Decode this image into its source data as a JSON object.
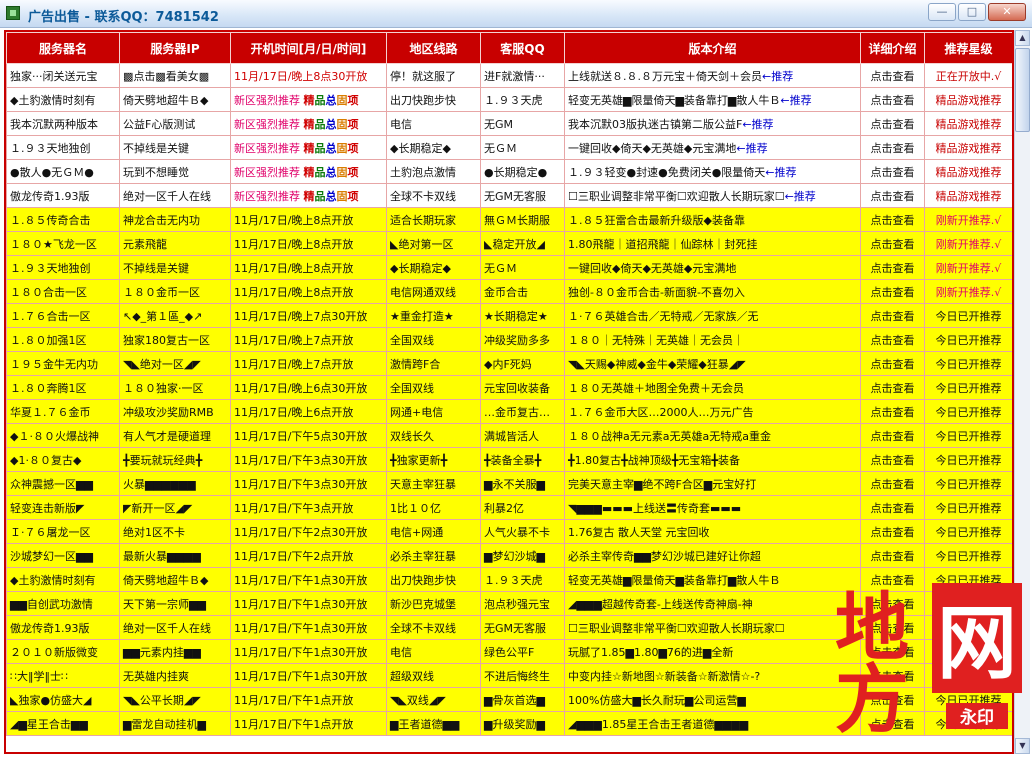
{
  "window": {
    "title": "广告出售 - 联系QQ：7481542",
    "minimize": "—",
    "maximize": "□",
    "close": "✕"
  },
  "headers": [
    "服务器名",
    "服务器IP",
    "开机时间[月/日/时间]",
    "地区线路",
    "客服QQ",
    "版本介绍",
    "详细介绍",
    "推荐星级"
  ],
  "rows": [
    {
      "style": "w",
      "name": "独家···闭关送元宝",
      "ip": "▩点击▩看美女▩",
      "time": "11月/17日/晚上8点30开放",
      "line": "停！就这服了",
      "qq": "进F就激情···",
      "intro": "上线就送８.８.８万元宝＋倚天剑＋会员",
      "intro_tail": "←推荐",
      "detail": "点击查看",
      "rate": "正在开放中.√"
    },
    {
      "style": "w",
      "name": "◆土豹激情时刻有",
      "ip": "倚天劈地超牛Ｂ◆",
      "time": "新区强烈推荐",
      "tags": [
        "精",
        "品",
        "总",
        "固",
        "项"
      ],
      "line": "出刀快跑步快",
      "qq": "１.９３天虎",
      "intro": "轻变无英雄▆限量倚天▆装备靠打▆散人牛Ｂ",
      "intro_tail": "←推荐",
      "detail": "点击查看",
      "rate": "精品游戏推荐"
    },
    {
      "style": "w",
      "name": "我本沉默两种版本",
      "ip": "公益F心版测试",
      "time": "新区强烈推荐",
      "tags": [
        "精",
        "品",
        "总",
        "固",
        "项"
      ],
      "line": "电信",
      "qq": "无GM",
      "intro": "我本沉默03版执迷古镇第二版公益F",
      "intro_tail": "←推荐",
      "detail": "点击查看",
      "rate": "精品游戏推荐"
    },
    {
      "style": "w",
      "name": "１.９３天地独创",
      "ip": "不掉线是关键",
      "time": "新区强烈推荐",
      "tags": [
        "精",
        "品",
        "总",
        "固",
        "项"
      ],
      "line": "◆长期稳定◆",
      "qq": "无ＧＭ",
      "intro": "一键回收◆倚天◆无英雄◆元宝满地",
      "intro_tail": "←推荐",
      "detail": "点击查看",
      "rate": "精品游戏推荐"
    },
    {
      "style": "w",
      "name": "●散人●无ＧＭ●",
      "ip": "玩到不想睡觉",
      "time": "新区强烈推荐",
      "tags": [
        "精",
        "品",
        "总",
        "固",
        "项"
      ],
      "line": "土豹泡点激情",
      "qq": "●长期稳定●",
      "intro": "１.９３轻变●封速●免费闭关●限量倚天",
      "intro_tail": "←推荐",
      "detail": "点击查看",
      "rate": "精品游戏推荐"
    },
    {
      "style": "w",
      "name": "傲龙传奇1.93版",
      "ip": "绝对一区千人在线",
      "time": "新区强烈推荐",
      "tags": [
        "精",
        "品",
        "总",
        "固",
        "项"
      ],
      "line": "全球不卡双线",
      "qq": "无GM无客服",
      "intro": "☐三职业调整非常平衡☐欢迎散人长期玩家☐",
      "intro_tail": "←推荐",
      "detail": "点击查看",
      "rate": "精品游戏推荐"
    },
    {
      "style": "y",
      "name": "１.８５传奇合击",
      "ip": "神龙合击无内功",
      "time": "11月/17日/晚上8点开放",
      "line": "适合长期玩家",
      "qq": "無ＧＭ长期服",
      "intro": "１.８５狂雷合击最新升级版◆装备靠",
      "detail": "点击查看",
      "rate": "刚新开推荐.√",
      "hot": true
    },
    {
      "style": "y",
      "name": "１８０★飞龙一区",
      "ip": "元素飛龍",
      "time": "11月/17日/晚上8点开放",
      "line": "◣绝对第一区",
      "qq": "◣稳定开放◢",
      "intro": "1.80飛龍｜道招飛龍｜仙踪林｜封死挂",
      "detail": "点击查看",
      "rate": "刚新开推荐.√",
      "hot": true
    },
    {
      "style": "y",
      "name": "１.９３天地独创",
      "ip": "不掉线是关键",
      "time": "11月/17日/晚上8点开放",
      "line": "◆长期稳定◆",
      "qq": "无ＧＭ",
      "intro": "一键回收◆倚天◆无英雄◆元宝满地",
      "detail": "点击查看",
      "rate": "刚新开推荐.√",
      "hot": true
    },
    {
      "style": "y",
      "name": "１８０合击一区",
      "ip": "１８０金币一区",
      "time": "11月/17日/晚上8点开放",
      "line": "电信网通双线",
      "qq": "金币合击",
      "intro": "独创-８０金币合击-新面貌-不喜勿入",
      "detail": "点击查看",
      "rate": "刚新开推荐.√",
      "hot": true
    },
    {
      "style": "y",
      "name": "１.７６合击一区",
      "ip": "↖◆_第１區_◆↗",
      "time": "11月/17日/晚上7点30开放",
      "line": "★重金打造★",
      "qq": "★长期稳定★",
      "intro": "１·７６英雄合击／无特戒／无家族／无",
      "detail": "点击查看",
      "rate": "今日已开推荐"
    },
    {
      "style": "y",
      "name": "１.８０加强1区",
      "ip": "独家180复古一区",
      "time": "11月/17日/晚上7点开放",
      "line": "全国双线",
      "qq": "冲级奖励多多",
      "intro": "１８０｜无特殊｜无英雄｜无会员｜",
      "detail": "点击查看",
      "rate": "今日已开推荐"
    },
    {
      "style": "y",
      "name": "１９５金牛无内功",
      "ip": "◥◣绝对一区◢◤",
      "time": "11月/17日/晚上7点开放",
      "line": "激情跨F合",
      "qq": "◆内F死妈",
      "intro": "◥◣天赐◆神威◆金牛◆荣耀◆狂暴◢◤",
      "detail": "点击查看",
      "rate": "今日已开推荐"
    },
    {
      "style": "y",
      "name": "１.８０奔腾1区",
      "ip": "１８０独家·一区",
      "time": "11月/17日/晚上6点30开放",
      "line": "全国双线",
      "qq": "元宝回收装备",
      "intro": "１８０无英雄＋地图全免费＋无会员",
      "detail": "点击查看",
      "rate": "今日已开推荐"
    },
    {
      "style": "y",
      "name": "华夏１.７６金币",
      "ip": "冲级攻沙奖励RMB",
      "time": "11月/17日/晚上6点开放",
      "line": "网通+电信",
      "qq": "…金币复古…",
      "intro": "１.７６金币大区…2000人…万元广告",
      "detail": "点击查看",
      "rate": "今日已开推荐"
    },
    {
      "style": "y",
      "name": "◆１·８０火爆战神",
      "ip": "有人气才是硬道理",
      "time": "11月/17日/下午5点30开放",
      "line": "双线长久",
      "qq": "满城皆活人",
      "intro": "１８０战神a无元素a无英雄a无特戒a重金",
      "detail": "点击查看",
      "rate": "今日已开推荐"
    },
    {
      "style": "y",
      "name": "◆1·８０复古◆",
      "ip": "╋要玩就玩经典╋",
      "time": "11月/17日/下午3点30开放",
      "line": "╋独家更新╋",
      "qq": "╋装备全暴╋",
      "intro": "╋1.80复古╋战神顶级╋无宝箱╋装备",
      "detail": "点击查看",
      "rate": "今日已开推荐"
    },
    {
      "style": "y",
      "name": "众神震撼一区▆▆",
      "ip": "火暴▆▆▆▆▆▆",
      "time": "11月/17日/下午3点30开放",
      "line": "天意主宰狂暴",
      "qq": "▆永不关服▆",
      "intro": "完美天意主宰▆绝不跨F合区▆元宝好打",
      "detail": "点击查看",
      "rate": "今日已开推荐"
    },
    {
      "style": "y",
      "name": "轻变连击新版◤",
      "ip": "◤新开一区◢◤",
      "time": "11月/17日/下午3点开放",
      "line": "1比１０亿",
      "qq": "利暴2亿",
      "intro": "◥▆▆▆▬▬▬上线送〓传奇套▬▬▬",
      "detail": "点击查看",
      "rate": "今日已开推荐"
    },
    {
      "style": "y",
      "name": "Ｉ·７６屠龙一区",
      "ip": "绝对1区不卡",
      "time": "11月/17日/下午2点30开放",
      "line": "电信+网通",
      "qq": "人气火暴不卡",
      "intro": "1.76复古 散人天堂 元宝回收",
      "detail": "点击查看",
      "rate": "今日已开推荐"
    },
    {
      "style": "y",
      "name": "沙城梦幻一区▆▆",
      "ip": "最新火暴▆▆▆▆",
      "time": "11月/17日/下午2点开放",
      "line": "必杀主宰狂暴",
      "qq": "▆梦幻沙城▆",
      "intro": "必杀主宰传奇▆▆梦幻沙城已建好让你超",
      "detail": "点击查看",
      "rate": "今日已开推荐"
    },
    {
      "style": "y",
      "name": "◆土豹激情时刻有",
      "ip": "倚天劈地超牛Ｂ◆",
      "time": "11月/17日/下午1点30开放",
      "line": "出刀快跑步快",
      "qq": "１.９３天虎",
      "intro": "轻变无英雄▆限量倚天▆装备靠打▆散人牛Ｂ",
      "detail": "点击查看",
      "rate": "今日已开推荐"
    },
    {
      "style": "y",
      "name": "▆▆自创武功激情",
      "ip": "天下第一宗师▆▆",
      "time": "11月/17日/下午1点30开放",
      "line": "新沙巴克城堡",
      "qq": "泡点秒强元宝",
      "intro": "◢▆▆▆超越传奇套-上线送传奇神扇-神",
      "detail": "点击查看",
      "rate": "今日已开推荐"
    },
    {
      "style": "y",
      "name": "傲龙传奇1.93版",
      "ip": "绝对一区千人在线",
      "time": "11月/17日/下午1点30开放",
      "line": "全球不卡双线",
      "qq": "无GM无客服",
      "intro": "☐三职业调整非常平衡☐欢迎散人长期玩家☐",
      "detail": "点击查看",
      "rate": "今日已开推荐"
    },
    {
      "style": "y",
      "name": "２０１０新版微变",
      "ip": "▆▆元素内挂▆▆",
      "time": "11月/17日/下午1点30开放",
      "line": "电信",
      "qq": "绿色公平F",
      "intro": "玩腻了1.85▆1.80▆76的进▆全新",
      "detail": "点击查看",
      "rate": "今日已开推荐"
    },
    {
      "style": "y",
      "name": "∷大‖学‖士∷",
      "ip": "无英雄内挂爽",
      "time": "11月/17日/下午1点30开放",
      "line": "超级双线",
      "qq": "不进后悔终生",
      "intro": "中变内挂☆新地图☆新装备☆新激情☆-?",
      "detail": "点击查看",
      "rate": "今日已开推荐"
    },
    {
      "style": "y",
      "name": "◣独家●仿盛大◢",
      "ip": "◥◣公平长期◢◤",
      "time": "11月/17日/下午1点开放",
      "line": "◥◣双线◢◤",
      "qq": "▆骨灰首选▆",
      "intro": "100%仿盛大▆长久耐玩▆公司运营▆",
      "detail": "点击查看",
      "rate": "今日已开推荐"
    },
    {
      "style": "y",
      "name": "◢▆星王合击▆▆",
      "ip": "▆雷龙自动挂机▆",
      "time": "11月/17日/下午1点开放",
      "line": "▆王者道德▆▆",
      "qq": "▆升级奖励▆",
      "intro": "◢▆▆▆1.85星王合击王者道德▆▆▆▆",
      "detail": "点击查看",
      "rate": "今日已开推荐"
    }
  ],
  "stamp": {
    "left": "地方",
    "right": "网",
    "seal": "永印"
  },
  "colors": {
    "header_bg": "#c80000",
    "highlight": "#ffff00"
  }
}
